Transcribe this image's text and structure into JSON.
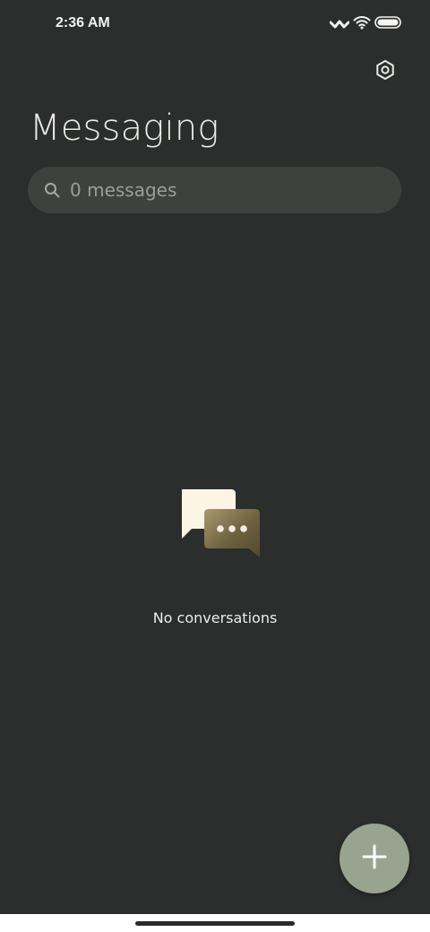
{
  "status_bar": {
    "time": "2:36 AM",
    "icons": [
      "signal-icon",
      "wifi-icon",
      "battery-icon"
    ]
  },
  "header": {
    "title": "Messaging",
    "settings_icon": "settings-icon"
  },
  "search": {
    "placeholder": "0 messages",
    "icon": "search-icon"
  },
  "empty_state": {
    "illustration": "chat-bubbles-icon",
    "message": "No conversations"
  },
  "fab": {
    "icon": "plus-icon",
    "color": "#98a48f"
  },
  "theme": {
    "background": "#2c2e2d",
    "search_background": "#3f413f",
    "accent": "#98a48f"
  }
}
